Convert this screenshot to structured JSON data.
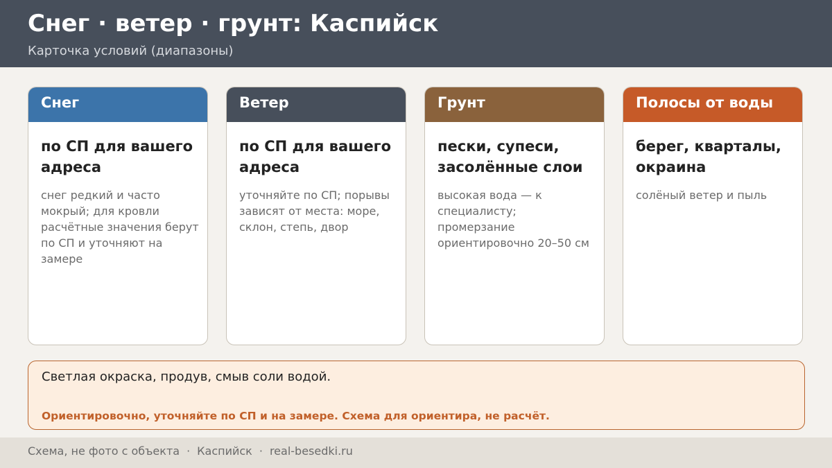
{
  "header": {
    "title": "Снег · ветер · грунт: Каспийск",
    "subtitle": "Карточка условий (диапазоны)"
  },
  "cards": [
    {
      "heading": "Снег",
      "color": "#3c74aa",
      "title": "по СП для вашего адреса",
      "text": "снег редкий и часто мокрый; для кровли расчётные значения берут по СП и уточняют на замере"
    },
    {
      "heading": "Ветер",
      "color": "#474f5b",
      "title": "по СП для вашего адреса",
      "text": "уточняйте по СП; порывы зависят от места: море, склон, степь, двор"
    },
    {
      "heading": "Грунт",
      "color": "#8a623c",
      "title": "пески, супеси, засолённые слои",
      "text": "высокая вода — к специалисту; промерзание ориентировочно 20–50 см"
    },
    {
      "heading": "Полосы от воды",
      "color": "#c65a28",
      "title": "берег, кварталы, окраина",
      "text": "солёный ветер и пыль"
    }
  ],
  "note": {
    "text": "Светлая окраска, продув, смыв соли водой.",
    "warning": "Ориентировочно, уточняйте по СП и на замере. Схема для ориентира, не расчёт."
  },
  "footer": {
    "left": "Схема, не фото с объекта",
    "separator": "·",
    "city": "Каспийск",
    "site": "real-besedki.ru"
  }
}
